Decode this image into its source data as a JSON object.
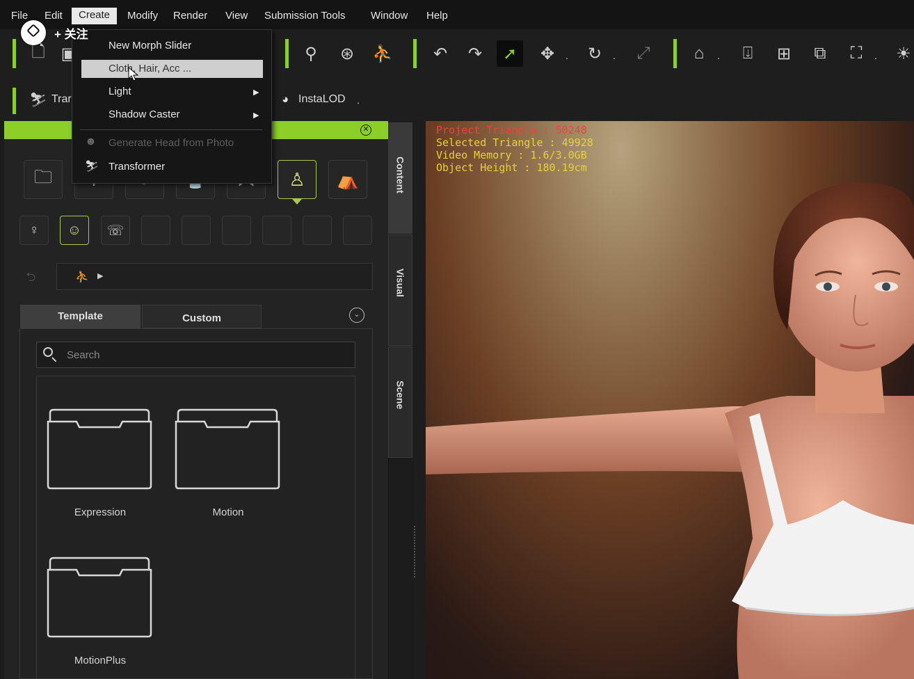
{
  "menubar": {
    "items": [
      "File",
      "Edit",
      "Create",
      "Modify",
      "Render",
      "View",
      "Submission Tools",
      "Window",
      "Help"
    ],
    "active": "Create"
  },
  "watermark": {
    "follow_label": "+ 关注"
  },
  "create_menu": {
    "items": [
      {
        "label": "New Morph Slider",
        "enabled": true,
        "submenu": false
      },
      {
        "label": "Cloth, Hair, Acc ...",
        "enabled": true,
        "submenu": false,
        "highlighted": true
      },
      {
        "label": "Light",
        "enabled": true,
        "submenu": true
      },
      {
        "label": "Shadow Caster",
        "enabled": true,
        "submenu": true
      },
      {
        "label": "Generate Head from Photo",
        "enabled": false,
        "submenu": false
      },
      {
        "label": "Transformer",
        "enabled": true,
        "submenu": false
      }
    ]
  },
  "toolbar2": {
    "transformer_label": "Trar",
    "instalod_label": "InstaLOD"
  },
  "content_panel": {
    "tabs": [
      "Template",
      "Custom"
    ],
    "active_tab": "Template",
    "search_placeholder": "Search",
    "folders": [
      "Expression",
      "Motion",
      "MotionPlus"
    ]
  },
  "side_tabs": [
    "Content",
    "Visual",
    "Scene"
  ],
  "viewport_stats": {
    "project_triangle": "Project Triangle : 50248",
    "selected_triangle": "Selected Triangle : 49928",
    "video_memory": "Video Memory : 1.6/3.0GB",
    "object_height": "Object Height : 180.19cm"
  },
  "colors": {
    "accent": "#8ccf28",
    "stat_red": "#e8463a",
    "stat_yellow": "#e6d23a",
    "menu_bg": "#161616"
  }
}
